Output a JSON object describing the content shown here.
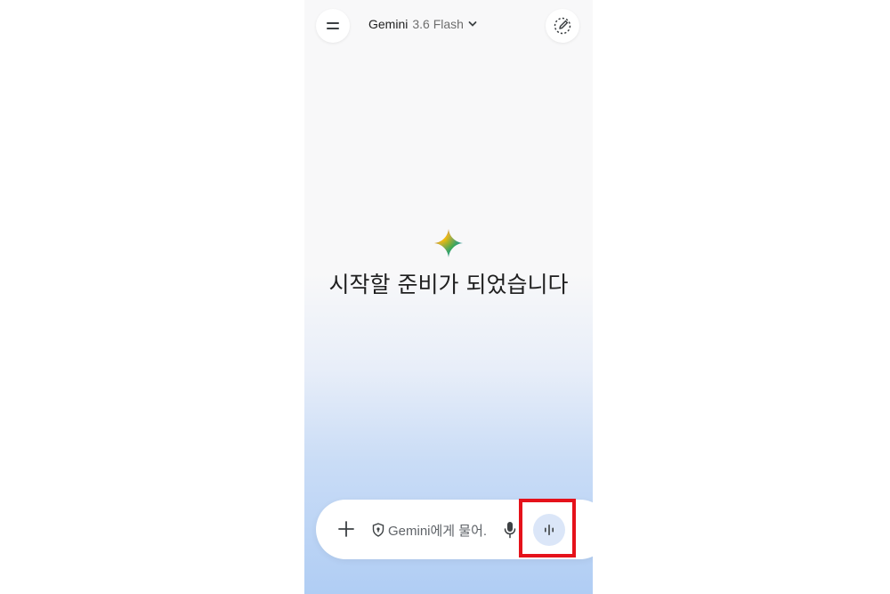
{
  "header": {
    "menu_icon": "hamburger-icon",
    "model_name": "Gemini",
    "model_version": "3.6 Flash",
    "model_dropdown_icon": "chevron-down-icon",
    "new_chat_icon": "edit-pencil-icon"
  },
  "main": {
    "logo_icon": "gemini-sparkle-icon",
    "headline": "시작할 준비가 되었습니다"
  },
  "input_bar": {
    "add_icon": "plus-icon",
    "privacy_icon": "shield-icon",
    "placeholder": "Gemini에게 물어.",
    "mic_icon": "microphone-icon",
    "live_icon": "waveform-icon"
  },
  "annotation": {
    "highlight_color": "#e5121b",
    "highlight_target": "live-button"
  },
  "colors": {
    "background_top": "#f8f8f9",
    "background_bottom": "#b0cdf4",
    "live_button_bg": "#dbe6f8"
  }
}
